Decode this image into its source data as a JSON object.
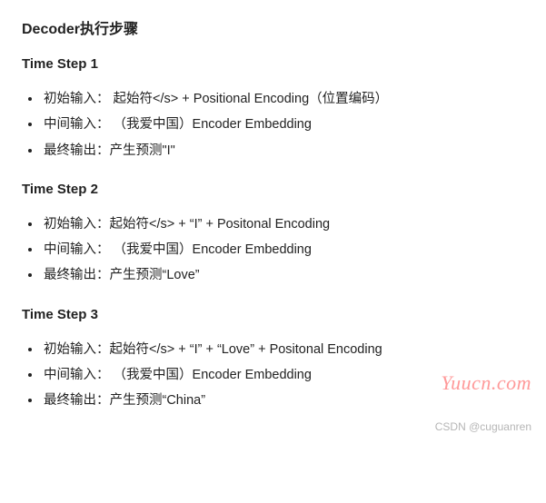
{
  "title": "Decoder执行步骤",
  "steps": [
    {
      "heading": "Time Step 1",
      "items": [
        "初始输入：  起始符</s> + Positional Encoding（位置编码）",
        "中间输入： （我爱中国）Encoder Embedding",
        "最终输出：产生预测\"I\""
      ]
    },
    {
      "heading": "Time Step 2",
      "items": [
        "初始输入：起始符</s> + “I” + Positonal Encoding",
        "中间输入： （我爱中国）Encoder Embedding",
        "最终输出：产生预测“Love”"
      ]
    },
    {
      "heading": "Time Step 3",
      "items": [
        "初始输入：起始符</s> + “I” + “Love” + Positonal Encoding",
        "中间输入： （我爱中国）Encoder Embedding",
        "最终输出：产生预测“China”"
      ]
    }
  ],
  "watermark_brand": "Yuucn.com",
  "watermark_author": "CSDN @cuguanren"
}
